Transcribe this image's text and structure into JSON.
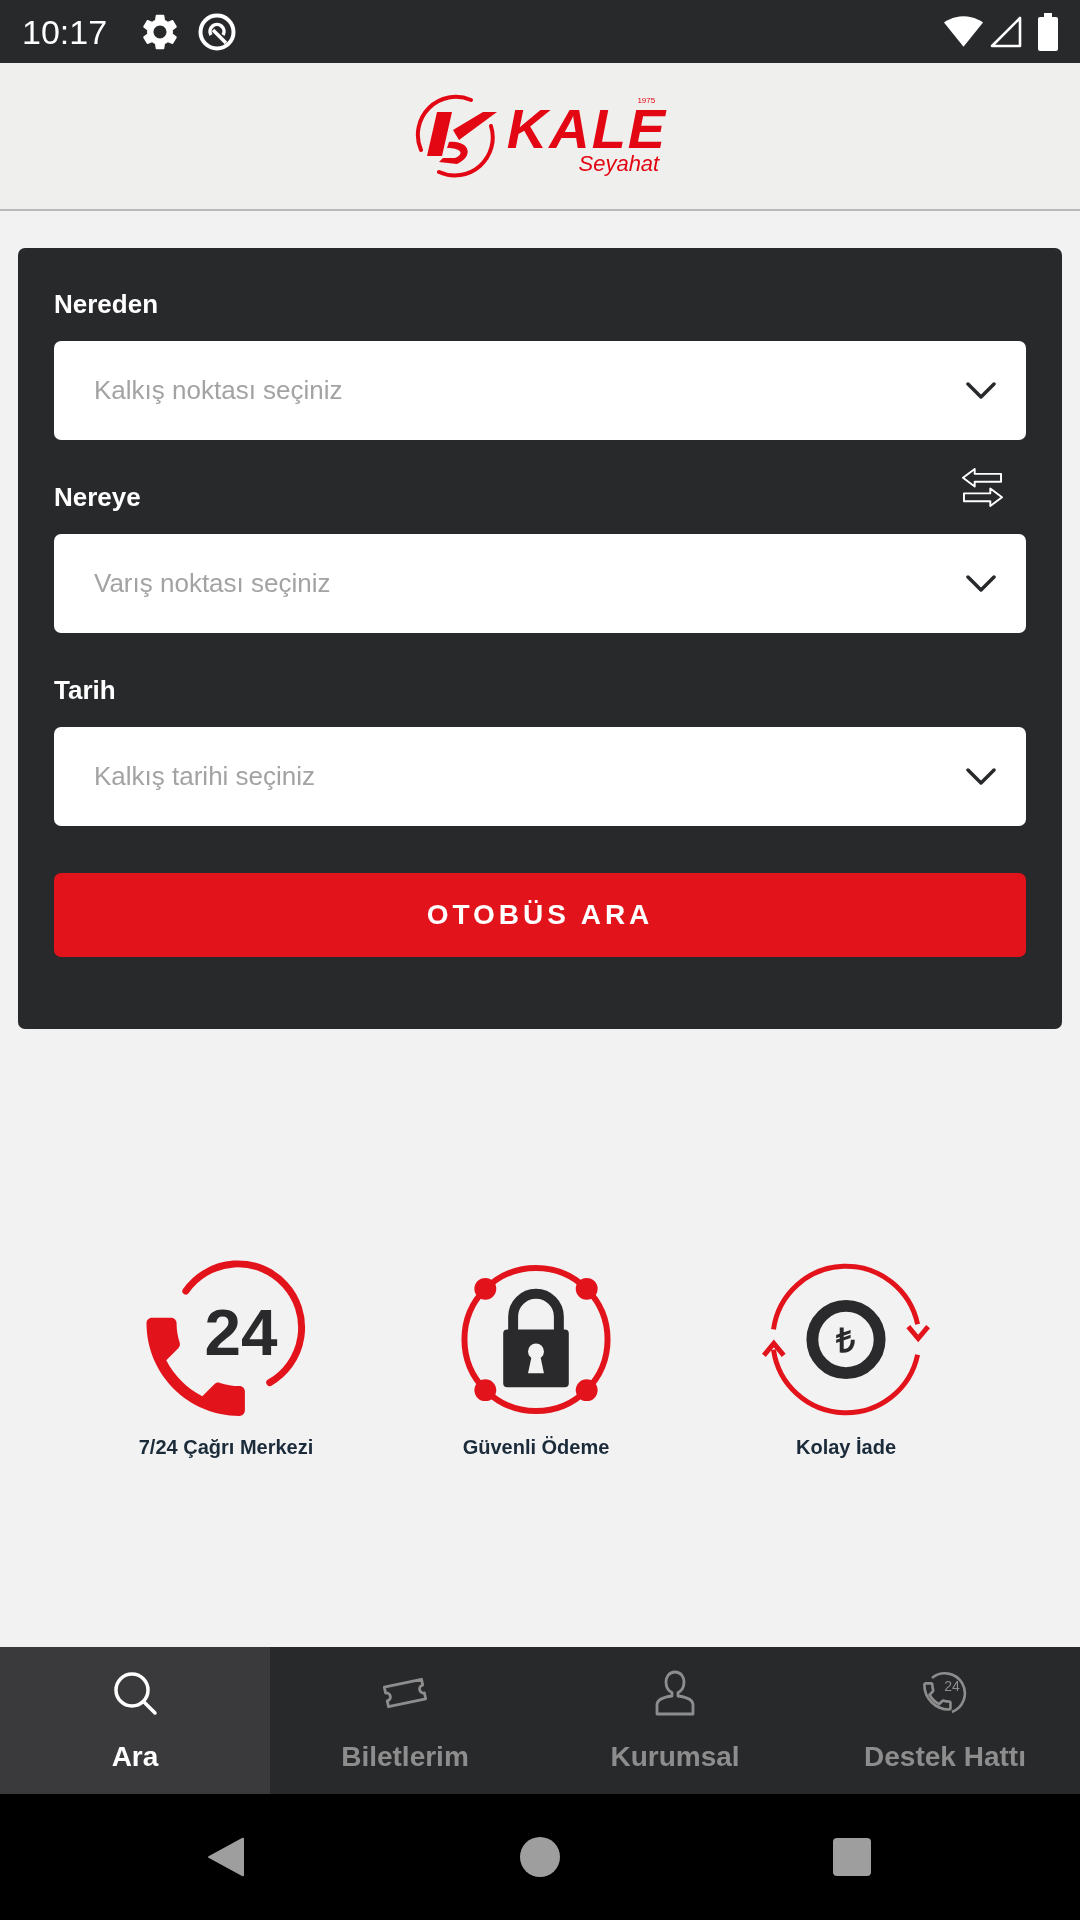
{
  "status_bar": {
    "time": "10:17"
  },
  "header": {
    "logo": {
      "since": "1975",
      "wordmark": "KALE",
      "tagline": "Seyahat"
    }
  },
  "search_form": {
    "fields": [
      {
        "label": "Nereden",
        "placeholder": "Kalkış noktası seçiniz",
        "swap": false
      },
      {
        "label": "Nereye",
        "placeholder": "Varış noktası seçiniz",
        "swap": true
      },
      {
        "label": "Tarih",
        "placeholder": "Kalkış tarihi seçiniz",
        "swap": false
      }
    ],
    "submit_button": "OTOBÜS ARA"
  },
  "features": [
    {
      "kind": "call_center",
      "icon_text": "24",
      "label": "7/24 Çağrı Merkezi"
    },
    {
      "kind": "secure_payment",
      "label": "Güvenli Ödeme"
    },
    {
      "kind": "refund",
      "icon_text": "₺",
      "label": "Kolay İade"
    }
  ],
  "bottom_nav": [
    {
      "kind": "search",
      "label": "Ara",
      "selected": true
    },
    {
      "kind": "tickets",
      "label": "Biletlerim",
      "selected": false
    },
    {
      "kind": "corporate",
      "label": "Kurumsal",
      "selected": false
    },
    {
      "kind": "support",
      "icon_text": "24",
      "label": "Destek Hattı",
      "selected": false
    }
  ]
}
